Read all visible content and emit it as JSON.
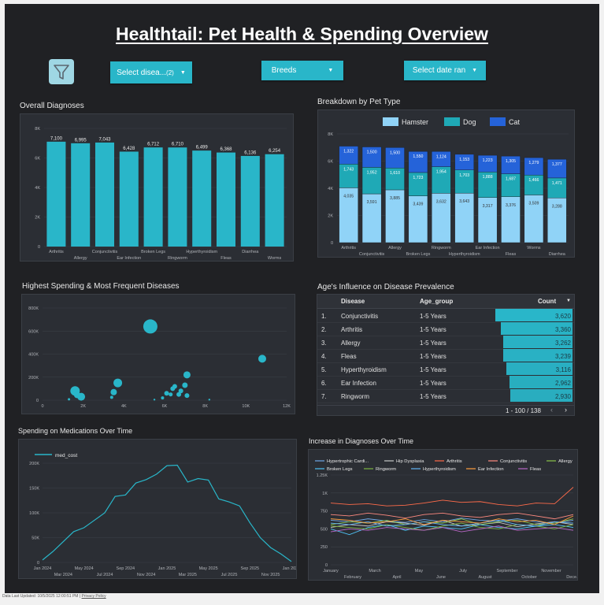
{
  "header": {
    "title": "Healthtail: Pet Health & Spending Overview"
  },
  "filters": {
    "disease_label": "Select disea...",
    "disease_count": "(2)",
    "breeds_label": "Breeds",
    "date_label": "Select date ran"
  },
  "sections": {
    "overall": "Overall Diagnoses",
    "breakdown": "Breakdown by Pet Type",
    "spending": "Highest Spending & Most Frequent Diseases",
    "age": "Age's Influence on Disease Prevalence",
    "meds": "Spending on Medications Over Time",
    "increase": "Increase in Diagnoses Over Time"
  },
  "colors": {
    "teal": "#29b6c9",
    "hamster": "#90d3f7",
    "dog": "#1fa9b6",
    "cat": "#2563d9",
    "panel": "#2b2e34"
  },
  "chart_data": [
    {
      "id": "overall",
      "type": "bar",
      "categories": [
        "Arthritis",
        "Allergy",
        "Conjunctivitis",
        "Ear Infection",
        "Broken Legs",
        "Ringworm",
        "Hyperthyroidism",
        "Fleas",
        "Diarrhea",
        "Worms"
      ],
      "values": [
        7100,
        6995,
        7043,
        6428,
        6712,
        6710,
        6499,
        6368,
        6136,
        6254
      ],
      "value_labels": [
        "7,100",
        "6,995",
        "7,043",
        "6,428",
        "6,712",
        "6,710",
        "6,499",
        "6,368",
        "6,136",
        "6,254"
      ],
      "ylim": [
        0,
        8000
      ],
      "yticks": [
        "0",
        "2K",
        "4K",
        "6K",
        "8K"
      ]
    },
    {
      "id": "breakdown",
      "type": "bar",
      "stacked": true,
      "categories": [
        "Arthritis",
        "Conjunctivitis",
        "Allergy",
        "Broken Legs",
        "Ringworm",
        "Hyperthyroidism",
        "Ear Infection",
        "Fleas",
        "Worms",
        "Diarrhea"
      ],
      "series": [
        {
          "name": "Hamster",
          "values": [
            4035,
            3591,
            3885,
            3439,
            3632,
            3643,
            3317,
            3376,
            3509,
            3288
          ],
          "labels": [
            "4,035",
            "3,591",
            "3,885",
            "3,439",
            "3,632",
            "3,643",
            "3,317",
            "3,376",
            "3,509",
            "3,288"
          ]
        },
        {
          "name": "Dog",
          "values": [
            1743,
            1952,
            1610,
            1723,
            1954,
            1703,
            1888,
            1687,
            1466,
            1471
          ],
          "labels": [
            "1,743",
            "1,952",
            "1,610",
            "1,723",
            "1,954",
            "1,703",
            "1,888",
            "1,687",
            "1,466",
            "1,471"
          ]
        },
        {
          "name": "Cat",
          "values": [
            1322,
            1500,
            1500,
            1550,
            1124,
            1153,
            1223,
            1305,
            1279,
            1377
          ],
          "labels": [
            "1,322",
            "1,500",
            "1,500",
            "1,550",
            "1,124",
            "1,153",
            "1,223",
            "1,305",
            "1,279",
            "1,377"
          ]
        }
      ],
      "ylim": [
        0,
        8000
      ],
      "yticks": [
        "0",
        "2K",
        "4K",
        "6K",
        "8K"
      ],
      "legend": "top"
    },
    {
      "id": "spending",
      "type": "scatter",
      "points": [
        {
          "x": 1600,
          "y": 80000,
          "r": 6
        },
        {
          "x": 1900,
          "y": 30000,
          "r": 5
        },
        {
          "x": 1700,
          "y": 45000,
          "r": 4
        },
        {
          "x": 1300,
          "y": 8000,
          "r": 1.5
        },
        {
          "x": 3400,
          "y": 25000,
          "r": 2
        },
        {
          "x": 3500,
          "y": 70000,
          "r": 4
        },
        {
          "x": 3700,
          "y": 150000,
          "r": 5.5
        },
        {
          "x": 5300,
          "y": 640000,
          "r": 9
        },
        {
          "x": 5500,
          "y": 5000,
          "r": 1.2
        },
        {
          "x": 5900,
          "y": 20000,
          "r": 2
        },
        {
          "x": 6100,
          "y": 60000,
          "r": 3
        },
        {
          "x": 6300,
          "y": 50000,
          "r": 2.5
        },
        {
          "x": 6400,
          "y": 100000,
          "r": 3
        },
        {
          "x": 6500,
          "y": 120000,
          "r": 3
        },
        {
          "x": 6700,
          "y": 50000,
          "r": 3
        },
        {
          "x": 6800,
          "y": 80000,
          "r": 3
        },
        {
          "x": 7000,
          "y": 130000,
          "r": 3.5
        },
        {
          "x": 7100,
          "y": 220000,
          "r": 4.5
        },
        {
          "x": 7100,
          "y": 40000,
          "r": 3
        },
        {
          "x": 8200,
          "y": 5000,
          "r": 1.2
        },
        {
          "x": 10800,
          "y": 360000,
          "r": 5
        }
      ],
      "xlim": [
        0,
        12000
      ],
      "ylim": [
        0,
        800000
      ],
      "xticks": [
        "0",
        "2K",
        "4K",
        "6K",
        "8K",
        "10K",
        "12K"
      ],
      "yticks": [
        "0",
        "200K",
        "400K",
        "600K",
        "800K"
      ]
    },
    {
      "id": "age",
      "type": "table",
      "columns": [
        "Disease",
        "Age_group",
        "Count"
      ],
      "rows": [
        {
          "n": "1.",
          "disease": "Conjunctivitis",
          "age": "1-5 Years",
          "count": 3620,
          "count_label": "3,620"
        },
        {
          "n": "2.",
          "disease": "Arthritis",
          "age": "1-5 Years",
          "count": 3360,
          "count_label": "3,360"
        },
        {
          "n": "3.",
          "disease": "Allergy",
          "age": "1-5 Years",
          "count": 3262,
          "count_label": "3,262"
        },
        {
          "n": "4.",
          "disease": "Fleas",
          "age": "1-5 Years",
          "count": 3239,
          "count_label": "3,239"
        },
        {
          "n": "5.",
          "disease": "Hyperthyroidism",
          "age": "1-5 Years",
          "count": 3116,
          "count_label": "3,116"
        },
        {
          "n": "6.",
          "disease": "Ear Infection",
          "age": "1-5 Years",
          "count": 2962,
          "count_label": "2,962"
        },
        {
          "n": "7.",
          "disease": "Ringworm",
          "age": "1-5 Years",
          "count": 2930,
          "count_label": "2,930"
        }
      ],
      "pagination": "1 - 100 / 138"
    },
    {
      "id": "meds",
      "type": "line",
      "series": [
        {
          "name": "med_cost",
          "values": [
            5000,
            22000,
            42000,
            62000,
            70000,
            85000,
            100000,
            133000,
            136000,
            160000,
            167000,
            178000,
            195000,
            196000,
            162000,
            169000,
            166000,
            128000,
            122000,
            114000,
            80000,
            50000,
            30000,
            17000,
            2000
          ]
        }
      ],
      "ylim": [
        0,
        200000
      ],
      "yticks": [
        "0",
        "50K",
        "100K",
        "150K",
        "200K"
      ],
      "xticks_top": [
        "Jan 2024",
        "May 2024",
        "Sep 2024",
        "Jan 2025",
        "May 2025",
        "Sep 2025",
        "Jan 2026"
      ],
      "xticks_bottom": [
        "Mar 2024",
        "Jul 2024",
        "Nov 2024",
        "Mar 2025",
        "Jul 2025",
        "Nov 2025"
      ]
    },
    {
      "id": "increase",
      "type": "line",
      "series": [
        {
          "name": "Hypertrophic Cardi...",
          "color": "#6fa8e8",
          "values": [
            620,
            600,
            640,
            610,
            590,
            630,
            600,
            650,
            620,
            610,
            640,
            600,
            580,
            620
          ]
        },
        {
          "name": "Hip Dysplasia",
          "color": "#c8c8c8",
          "values": [
            520,
            560,
            540,
            600,
            580,
            550,
            620,
            540,
            560,
            590,
            530,
            570,
            600,
            560
          ]
        },
        {
          "name": "Arthritis",
          "color": "#ff6b4a",
          "values": [
            860,
            840,
            850,
            820,
            830,
            860,
            900,
            870,
            880,
            840,
            820,
            860,
            850,
            1080
          ]
        },
        {
          "name": "Conjunctivitis",
          "color": "#ff8a80",
          "values": [
            700,
            680,
            720,
            690,
            650,
            700,
            720,
            680,
            660,
            700,
            720,
            680,
            640,
            700
          ]
        },
        {
          "name": "Allergy",
          "color": "#8bc34a",
          "values": [
            560,
            600,
            580,
            620,
            560,
            600,
            580,
            640,
            560,
            600,
            620,
            560,
            580,
            640
          ]
        },
        {
          "name": "Broken Legs",
          "color": "#4fc3f7",
          "values": [
            500,
            420,
            520,
            560,
            480,
            540,
            520,
            500,
            560,
            520,
            500,
            540,
            560,
            520
          ]
        },
        {
          "name": "Ringworm",
          "color": "#7cb342",
          "values": [
            540,
            520,
            500,
            560,
            520,
            480,
            540,
            580,
            520,
            500,
            560,
            540,
            500,
            560
          ]
        },
        {
          "name": "Hyperthyroidism",
          "color": "#64b5f6",
          "values": [
            580,
            560,
            600,
            540,
            560,
            600,
            560,
            540,
            580,
            620,
            560,
            540,
            600,
            580
          ]
        },
        {
          "name": "Ear Infection",
          "color": "#ff9e40",
          "values": [
            640,
            620,
            580,
            600,
            640,
            560,
            620,
            600,
            580,
            640,
            600,
            620,
            560,
            680
          ]
        },
        {
          "name": "Fleas",
          "color": "#ba68c8",
          "values": [
            460,
            500,
            480,
            520,
            500,
            480,
            520,
            460,
            500,
            540,
            480,
            500,
            520,
            480
          ]
        }
      ],
      "ylim": [
        0,
        1250
      ],
      "yticks": [
        "0",
        "250",
        "500",
        "750",
        "1K",
        "1.25K"
      ],
      "xticks_top": [
        "January",
        "March",
        "May",
        "July",
        "September",
        "November"
      ],
      "xticks_bottom": [
        "February",
        "April",
        "June",
        "August",
        "October",
        "Dece..."
      ]
    }
  ],
  "table_ui": {
    "prev_icon": "chevron-left-icon",
    "next_icon": "chevron-right-icon",
    "sort_icon": "sort-desc-icon"
  },
  "footer": {
    "updated": "Data Last Updated: 10/5/2025 12:00:51 PM",
    "privacy": "Privacy Policy"
  }
}
